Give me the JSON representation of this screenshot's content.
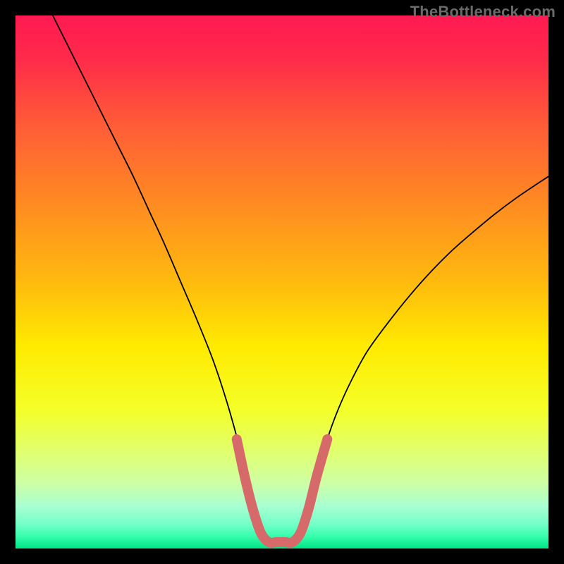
{
  "watermark": "TheBottleneck.com",
  "chart_data": {
    "type": "line",
    "title": "",
    "xlabel": "",
    "ylabel": "",
    "xlim": [
      0,
      100
    ],
    "ylim": [
      0,
      100
    ],
    "grid": false,
    "legend": false,
    "gradient_stops": [
      {
        "offset": 0.0,
        "color": "#ff1a52"
      },
      {
        "offset": 0.08,
        "color": "#ff2a4a"
      },
      {
        "offset": 0.2,
        "color": "#ff5a38"
      },
      {
        "offset": 0.35,
        "color": "#ff8a22"
      },
      {
        "offset": 0.5,
        "color": "#ffba0e"
      },
      {
        "offset": 0.62,
        "color": "#ffea00"
      },
      {
        "offset": 0.74,
        "color": "#f4ff28"
      },
      {
        "offset": 0.82,
        "color": "#e0ff70"
      },
      {
        "offset": 0.88,
        "color": "#ccffa8"
      },
      {
        "offset": 0.92,
        "color": "#a8ffd0"
      },
      {
        "offset": 0.955,
        "color": "#73ffc8"
      },
      {
        "offset": 0.975,
        "color": "#3bffb0"
      },
      {
        "offset": 1.0,
        "color": "#00e584"
      }
    ],
    "series": [
      {
        "name": "bottleneck-curve",
        "type": "line",
        "stroke": "#000000",
        "stroke_width": 1.8,
        "x": [
          7,
          10,
          13,
          16,
          19,
          22,
          25,
          28,
          31,
          34,
          37,
          39.5,
          41.5,
          43,
          44.5,
          46,
          48,
          52,
          54,
          55.5,
          57,
          58.5,
          60.5,
          63,
          66,
          70,
          74,
          78,
          82,
          86,
          90,
          94,
          98,
          100
        ],
        "y": [
          100,
          94,
          88,
          82,
          76,
          70,
          63.5,
          57,
          50,
          43,
          35.5,
          28,
          21,
          15,
          9.5,
          4.5,
          1.2,
          1.2,
          4.5,
          9.5,
          15,
          20.5,
          26,
          31.5,
          37,
          42.5,
          47.5,
          52,
          56,
          59.5,
          62.8,
          65.8,
          68.5,
          69.8
        ]
      },
      {
        "name": "bottom-marker",
        "type": "line",
        "stroke": "#d66a6a",
        "stroke_width": 14,
        "linecap": "round",
        "x": [
          41.5,
          43.0,
          44.5,
          46.0,
          47.5,
          49.0,
          50.5,
          52.0,
          53.5,
          55.0,
          56.5,
          58.5
        ],
        "y": [
          20.5,
          13.5,
          7.5,
          3.0,
          1.2,
          1.2,
          1.2,
          1.2,
          3.0,
          7.5,
          13.5,
          20.5
        ]
      }
    ]
  }
}
